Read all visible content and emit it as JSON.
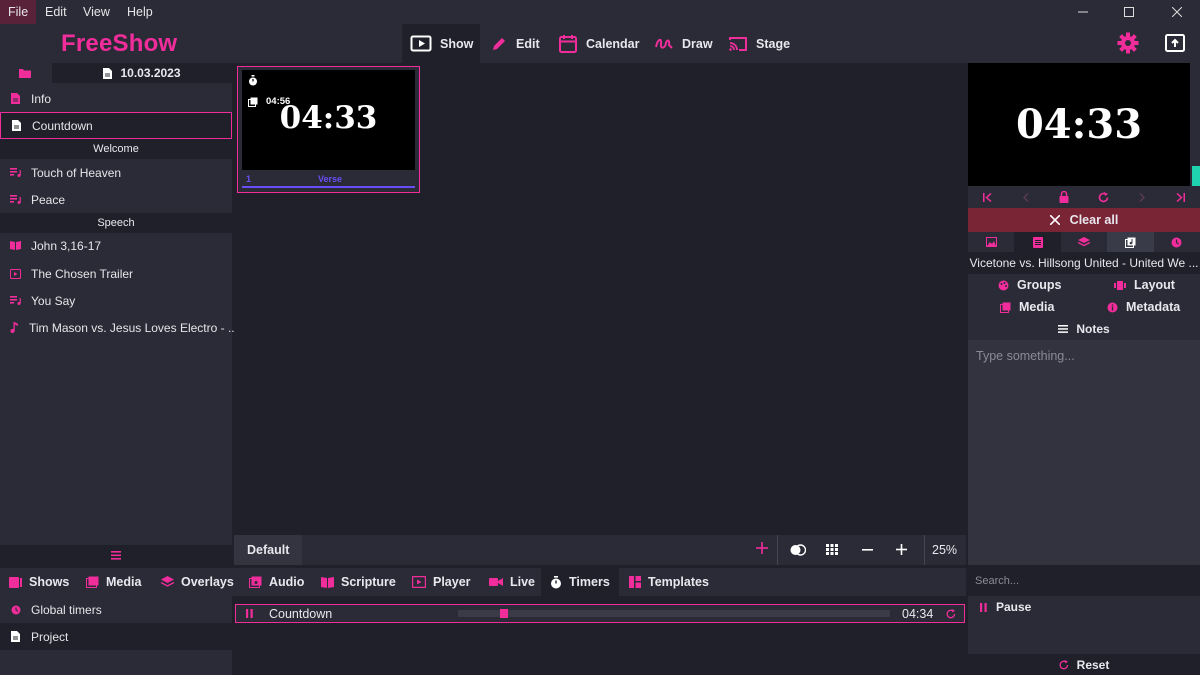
{
  "menu": {
    "file": "File",
    "edit": "Edit",
    "view": "View",
    "help": "Help"
  },
  "app": {
    "title": "FreeShow",
    "accent": "#f02d9b"
  },
  "topnav": {
    "show": "Show",
    "edit": "Edit",
    "calendar": "Calendar",
    "draw": "Draw",
    "stage": "Stage"
  },
  "project": {
    "date": "10.03.2023"
  },
  "sidebar": {
    "items": [
      {
        "label": "Info"
      },
      {
        "label": "Countdown"
      },
      {
        "header": "Welcome"
      },
      {
        "label": "Touch of Heaven"
      },
      {
        "label": "Peace"
      },
      {
        "header": "Speech"
      },
      {
        "label": "John 3,16-17"
      },
      {
        "label": "The Chosen Trailer"
      },
      {
        "label": "You Say"
      },
      {
        "label": "Tim Mason vs. Jesus Loves Electro - ..."
      }
    ]
  },
  "slide": {
    "timer_text": "04:33",
    "small_time": "04:56",
    "number": "1",
    "group": "Verse"
  },
  "slidebar": {
    "layout": "Default",
    "zoom": "25%"
  },
  "output": {
    "timer_text": "04:33"
  },
  "right": {
    "clear_all": "Clear all",
    "song_title": "Vicetone vs. Hillsong United - United We ...",
    "groups": "Groups",
    "layout": "Layout",
    "media": "Media",
    "metadata": "Metadata",
    "notes": "Notes",
    "notes_placeholder": "Type something..."
  },
  "bottom_tabs": {
    "shows": "Shows",
    "media": "Media",
    "overlays": "Overlays",
    "audio": "Audio",
    "scripture": "Scripture",
    "player": "Player",
    "live": "Live",
    "timers": "Timers",
    "templates": "Templates"
  },
  "timers_panel": {
    "global_timers": "Global timers",
    "project": "Project",
    "timer_name": "Countdown",
    "timer_value": "04:34",
    "progress": 0.097,
    "search_placeholder": "Search...",
    "pause": "Pause",
    "reset": "Reset"
  }
}
